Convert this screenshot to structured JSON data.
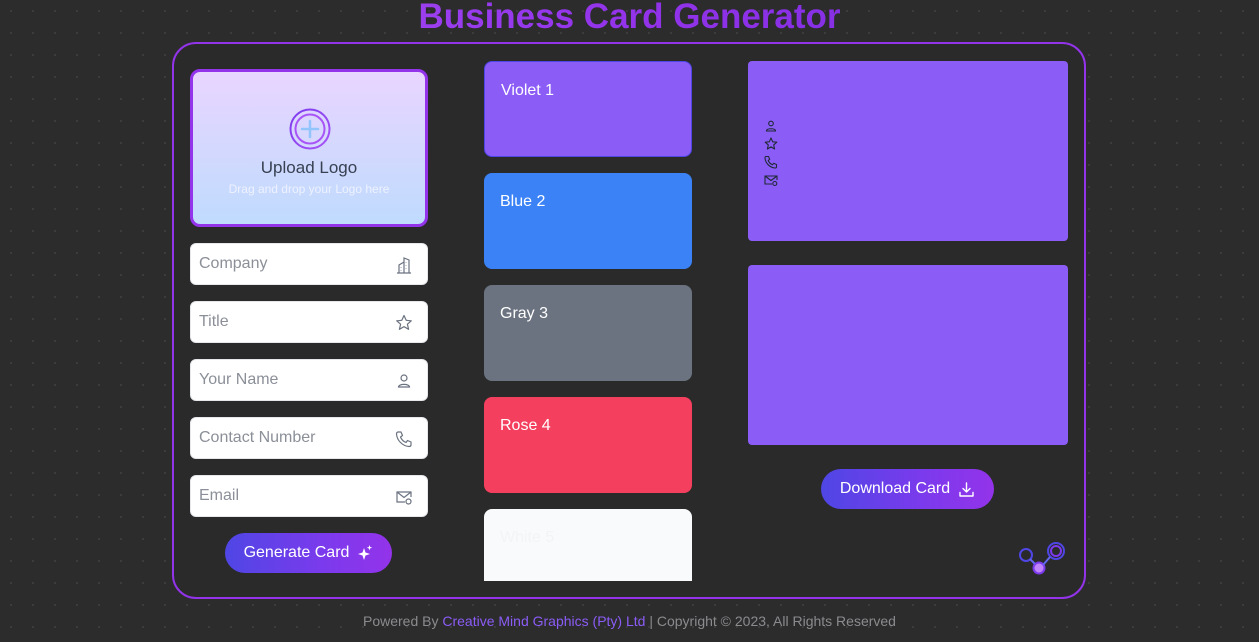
{
  "page": {
    "title": "Business Card Generator"
  },
  "upload": {
    "title": "Upload Logo",
    "subtitle": "Drag and drop your Logo here"
  },
  "form": {
    "company_placeholder": "Company",
    "title_placeholder": "Title",
    "name_placeholder": "Your Name",
    "contact_placeholder": "Contact Number",
    "email_placeholder": "Email",
    "generate_label": "Generate Card"
  },
  "themes": [
    {
      "label": "Violet 1",
      "color": "#8b5cf6"
    },
    {
      "label": "Blue 2",
      "color": "#3b82f6"
    },
    {
      "label": "Gray 3",
      "color": "#6b7280"
    },
    {
      "label": "Rose 4",
      "color": "#f43f5e"
    },
    {
      "label": "White 5",
      "color": "#f9fafb"
    }
  ],
  "preview": {
    "icons": [
      "user-icon",
      "star-icon",
      "phone-icon",
      "mail-icon"
    ],
    "download_label": "Download Card"
  },
  "footer": {
    "prefix": "Powered By",
    "company_link": "Creative Mind Graphics (Pty) Ltd",
    "suffix": "| Copyright © 2023, All Rights Reserved"
  },
  "colors": {
    "accent": "#9333ea",
    "card": "#8b5cf6",
    "background": "#2c2c2d"
  }
}
